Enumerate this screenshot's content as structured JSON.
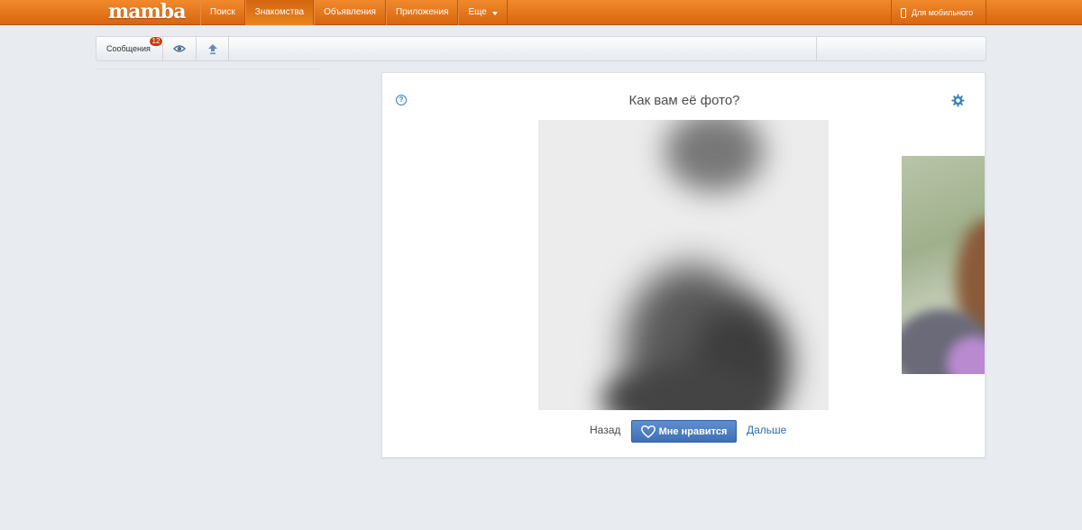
{
  "header": {
    "logo": "mamba",
    "nav": [
      {
        "label": "Поиск",
        "active": false
      },
      {
        "label": "Знакомства",
        "active": true
      },
      {
        "label": "Объявления",
        "active": false
      },
      {
        "label": "Приложения",
        "active": false
      },
      {
        "label": "Еще",
        "active": false
      }
    ],
    "mobile_label": "Для мобильного"
  },
  "toolbar": {
    "messages_label": "Сообщения",
    "messages_count": "12",
    "icons": [
      "eye-icon",
      "upload-arrow-icon"
    ]
  },
  "card": {
    "title": "Как вам её фото?",
    "help_icon": "question-icon",
    "settings_icon": "gear-icon",
    "back_label": "Назад",
    "like_label": "Мне нравится",
    "next_label": "Дальше"
  },
  "colors": {
    "header": "#e0711b",
    "like_button": "#4a7dc2",
    "link": "#2f6bb0",
    "badge": "#c73b15"
  }
}
